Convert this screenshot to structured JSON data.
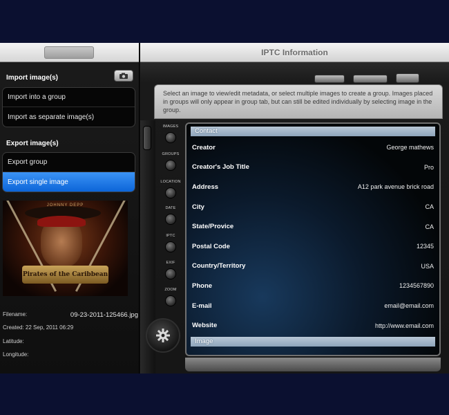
{
  "left": {
    "import_section": "Import image(s)",
    "import_items": [
      "Import into a group",
      "Import as separate image(s)"
    ],
    "export_section": "Export image(s)",
    "export_items": [
      "Export group",
      "Export single image"
    ],
    "export_selected": "Export single image",
    "poster": {
      "top_text": "JOHNNY DEPP",
      "logo_text": "Pirates of the Caribbean"
    },
    "meta": {
      "filename_label": "Filename:",
      "filename_value": "09-23-2011-125466.jpg",
      "created": "Created: 22 Sep, 2011 06:29",
      "latitude": "Latitude:",
      "longitude": "Longitude:"
    }
  },
  "right": {
    "title": "IPTC Information",
    "info_text": "Select an image to view/edit metadata, or select multiple images to create a group. Images placed in groups will only appear in group tab, but can still be edited individually by selecting image in the group.",
    "nav": [
      "IMAGES",
      "GROUPS",
      "LOCATION",
      "DATE",
      "IPTC",
      "EXIF",
      "ZOOM"
    ],
    "sections": {
      "contact": "Contact",
      "image": "Image"
    },
    "fields": [
      {
        "key": "Creator",
        "value": "George mathews"
      },
      {
        "key": "Creator's Job Title",
        "value": "Pro"
      },
      {
        "key": "Address",
        "value": "A12 park avenue brick road"
      },
      {
        "key": "City",
        "value": "CA"
      },
      {
        "key": "State/Provice",
        "value": "CA"
      },
      {
        "key": "Postal Code",
        "value": "12345"
      },
      {
        "key": "Country/Territory",
        "value": "USA"
      },
      {
        "key": "Phone",
        "value": "1234567890"
      },
      {
        "key": "E-mail",
        "value": "email@email.com"
      },
      {
        "key": "Website",
        "value": "http://www.email.com"
      }
    ]
  },
  "colors": {
    "page_bg": "#0b1030",
    "selected_row": "#0c65d8",
    "section_header": "#8ea5bb"
  }
}
